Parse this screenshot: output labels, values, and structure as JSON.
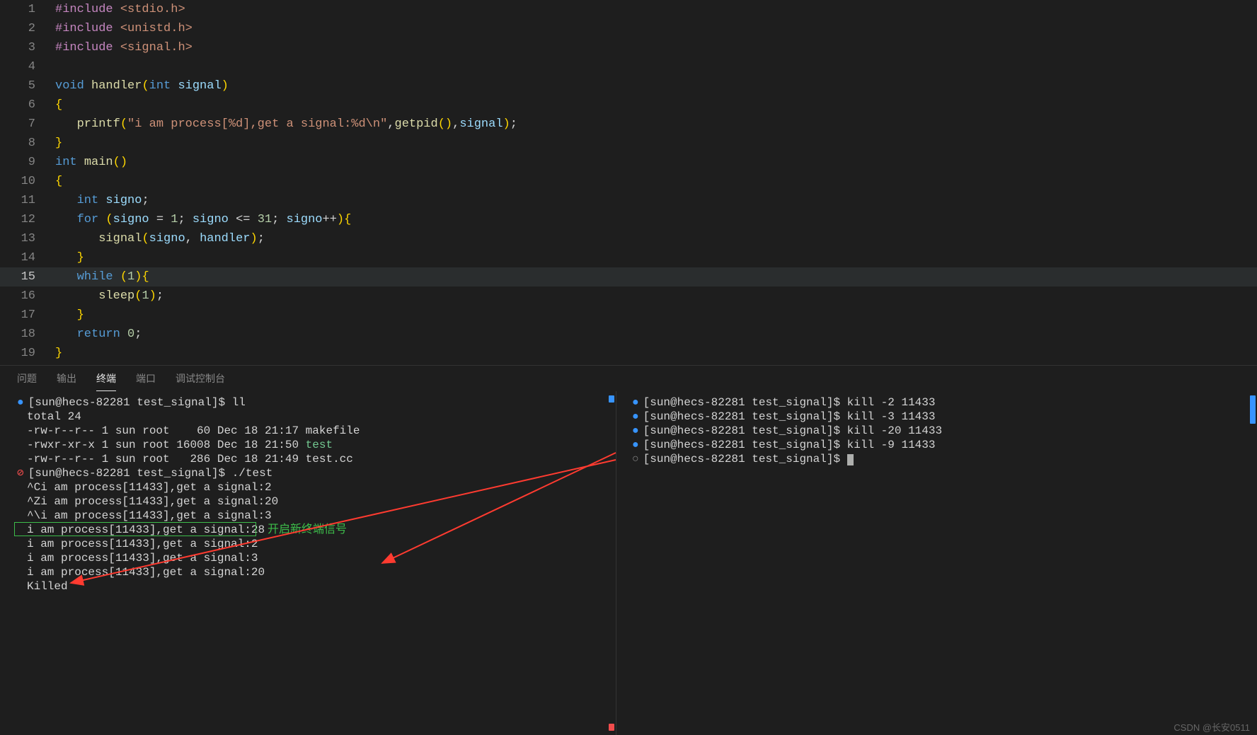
{
  "editor": {
    "lines": [
      {
        "n": 1,
        "html": "<span class='tok-directive'>#include</span> <span class='tok-include'>&lt;stdio.h&gt;</span>"
      },
      {
        "n": 2,
        "html": "<span class='tok-directive'>#include</span> <span class='tok-include'>&lt;unistd.h&gt;</span>"
      },
      {
        "n": 3,
        "html": "<span class='tok-directive'>#include</span> <span class='tok-include'>&lt;signal.h&gt;</span>"
      },
      {
        "n": 4,
        "html": ""
      },
      {
        "n": 5,
        "html": "<span class='tok-type'>void</span> <span class='tok-func'>handler</span><span class='tok-paren'>(</span><span class='tok-type'>int</span> <span class='tok-var'>signal</span><span class='tok-paren'>)</span>"
      },
      {
        "n": 6,
        "html": "<span class='tok-brace'>{</span>"
      },
      {
        "n": 7,
        "html": "   <span class='tok-func'>printf</span><span class='tok-paren'>(</span><span class='tok-string'>\"i am process[%d],get a signal:%d\\n\"</span><span class='tok-punct'>,</span><span class='tok-func'>getpid</span><span class='tok-paren'>()</span><span class='tok-punct'>,</span><span class='tok-var'>signal</span><span class='tok-paren'>)</span><span class='tok-punct'>;</span>"
      },
      {
        "n": 8,
        "html": "<span class='tok-brace'>}</span>"
      },
      {
        "n": 9,
        "html": "<span class='tok-type'>int</span> <span class='tok-func'>main</span><span class='tok-paren'>()</span>"
      },
      {
        "n": 10,
        "html": "<span class='tok-brace'>{</span>"
      },
      {
        "n": 11,
        "html": "   <span class='tok-type'>int</span> <span class='tok-var'>signo</span><span class='tok-punct'>;</span>"
      },
      {
        "n": 12,
        "html": "   <span class='tok-keyword'>for</span> <span class='tok-paren'>(</span><span class='tok-var'>signo</span> <span class='tok-op'>=</span> <span class='tok-number'>1</span><span class='tok-punct'>;</span> <span class='tok-var'>signo</span> <span class='tok-op'>&lt;=</span> <span class='tok-number'>31</span><span class='tok-punct'>;</span> <span class='tok-var'>signo</span><span class='tok-op'>++</span><span class='tok-paren'>)</span><span class='tok-brace'>{</span>"
      },
      {
        "n": 13,
        "html": "      <span class='tok-func'>signal</span><span class='tok-paren'>(</span><span class='tok-var'>signo</span><span class='tok-punct'>,</span> <span class='tok-var'>handler</span><span class='tok-paren'>)</span><span class='tok-punct'>;</span>"
      },
      {
        "n": 14,
        "html": "   <span class='tok-brace'>}</span>"
      },
      {
        "n": 15,
        "html": "   <span class='tok-keyword'>while</span> <span class='tok-paren'>(</span><span class='tok-number'>1</span><span class='tok-paren'>)</span><span class='tok-brace'>{</span>",
        "hl": true
      },
      {
        "n": 16,
        "html": "      <span class='tok-func'>sleep</span><span class='tok-paren'>(</span><span class='tok-number'>1</span><span class='tok-paren'>)</span><span class='tok-punct'>;</span>"
      },
      {
        "n": 17,
        "html": "   <span class='tok-brace'>}</span>"
      },
      {
        "n": 18,
        "html": "   <span class='tok-keyword'>return</span> <span class='tok-number'>0</span><span class='tok-punct'>;</span>"
      },
      {
        "n": 19,
        "html": "<span class='tok-brace'>}</span>"
      }
    ]
  },
  "panel": {
    "tabs": [
      "问题",
      "输出",
      "终端",
      "端口",
      "调试控制台"
    ],
    "active_tab": "终端"
  },
  "term_left": {
    "lines": [
      {
        "bullet": "blue",
        "text": "[sun@hecs-82281 test_signal]$ ll"
      },
      {
        "text": "total 24"
      },
      {
        "text": "-rw-r--r-- 1 sun root    60 Dec 18 21:17 makefile"
      },
      {
        "text": "-rwxr-xr-x 1 sun root 16008 Dec 18 21:50 ",
        "exec": "test"
      },
      {
        "text": "-rw-r--r-- 1 sun root   286 Dec 18 21:49 test.cc"
      },
      {
        "bullet": "err",
        "text": "[sun@hecs-82281 test_signal]$ ./test"
      },
      {
        "text": "^Ci am process[11433],get a signal:2"
      },
      {
        "text": "^Zi am process[11433],get a signal:20"
      },
      {
        "text": "^\\i am process[11433],get a signal:3"
      },
      {
        "text": "i am process[11433],get a signal:28",
        "boxed": true
      },
      {
        "text": "i am process[11433],get a signal:2"
      },
      {
        "text": "i am process[11433],get a signal:3"
      },
      {
        "text": "i am process[11433],get a signal:20"
      },
      {
        "text": "Killed"
      }
    ],
    "annotation": "开启新终端信号"
  },
  "term_right": {
    "lines": [
      {
        "bullet": "blue",
        "text": "[sun@hecs-82281 test_signal]$ kill -2 11433"
      },
      {
        "bullet": "blue",
        "text": "[sun@hecs-82281 test_signal]$ kill -3 11433"
      },
      {
        "bullet": "blue",
        "text": "[sun@hecs-82281 test_signal]$ kill -20 11433"
      },
      {
        "bullet": "blue",
        "text": "[sun@hecs-82281 test_signal]$ kill -9 11433"
      },
      {
        "bullet": "off",
        "text": "[sun@hecs-82281 test_signal]$ ",
        "cursor": true
      }
    ]
  },
  "watermark": "CSDN @长安0511"
}
